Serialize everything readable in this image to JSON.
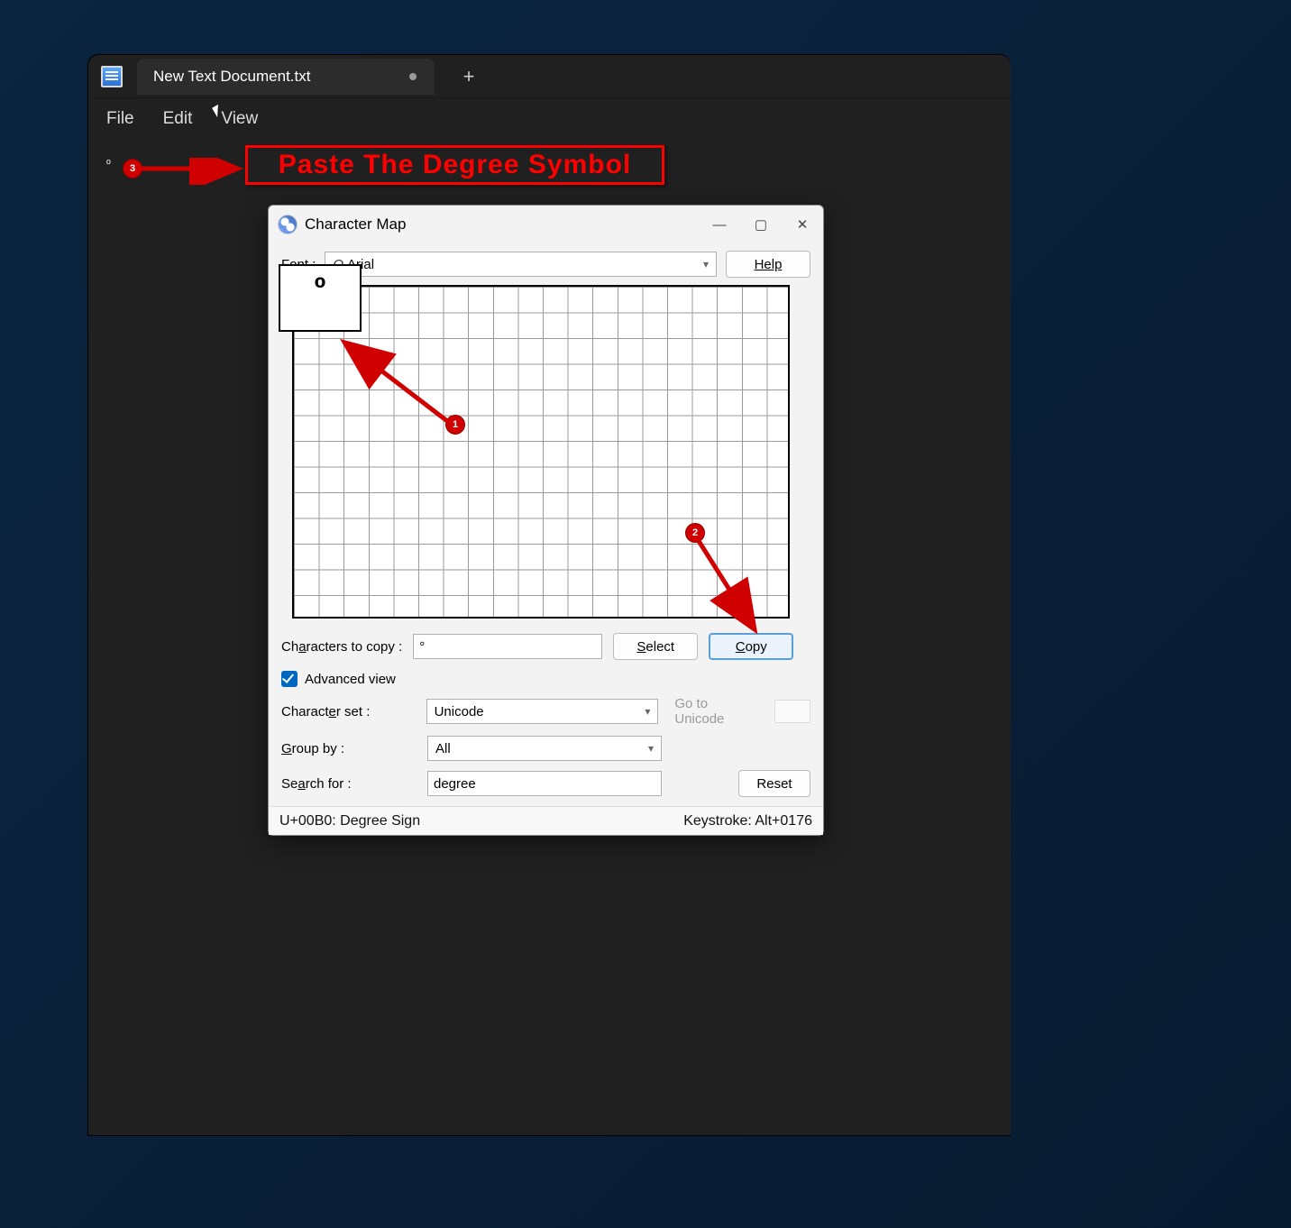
{
  "notepad": {
    "tab_title": "New Text Document.txt",
    "menus": {
      "file": "File",
      "edit": "Edit",
      "view": "View"
    },
    "editor_text": "º"
  },
  "annotation": {
    "callout": "Paste The Degree Symbol",
    "badge1": "1",
    "badge2": "2",
    "badge3": "3"
  },
  "charmap": {
    "title": "Character Map",
    "font_label": "Font :",
    "font_value": "Arial",
    "help": "Help",
    "zoom_char": "º",
    "chars_to_copy_label": "Characters to copy :",
    "chars_to_copy_value": "°",
    "select": "Select",
    "copy": "Copy",
    "advanced_view": "Advanced view",
    "charset_label": "Character set :",
    "charset_value": "Unicode",
    "goto_unicode": "Go to Unicode",
    "group_by_label": "Group by :",
    "group_by_value": "All",
    "search_label": "Search for :",
    "search_value": "degree",
    "reset": "Reset",
    "status_left": "U+00B0: Degree Sign",
    "status_right": "Keystroke: Alt+0176"
  }
}
